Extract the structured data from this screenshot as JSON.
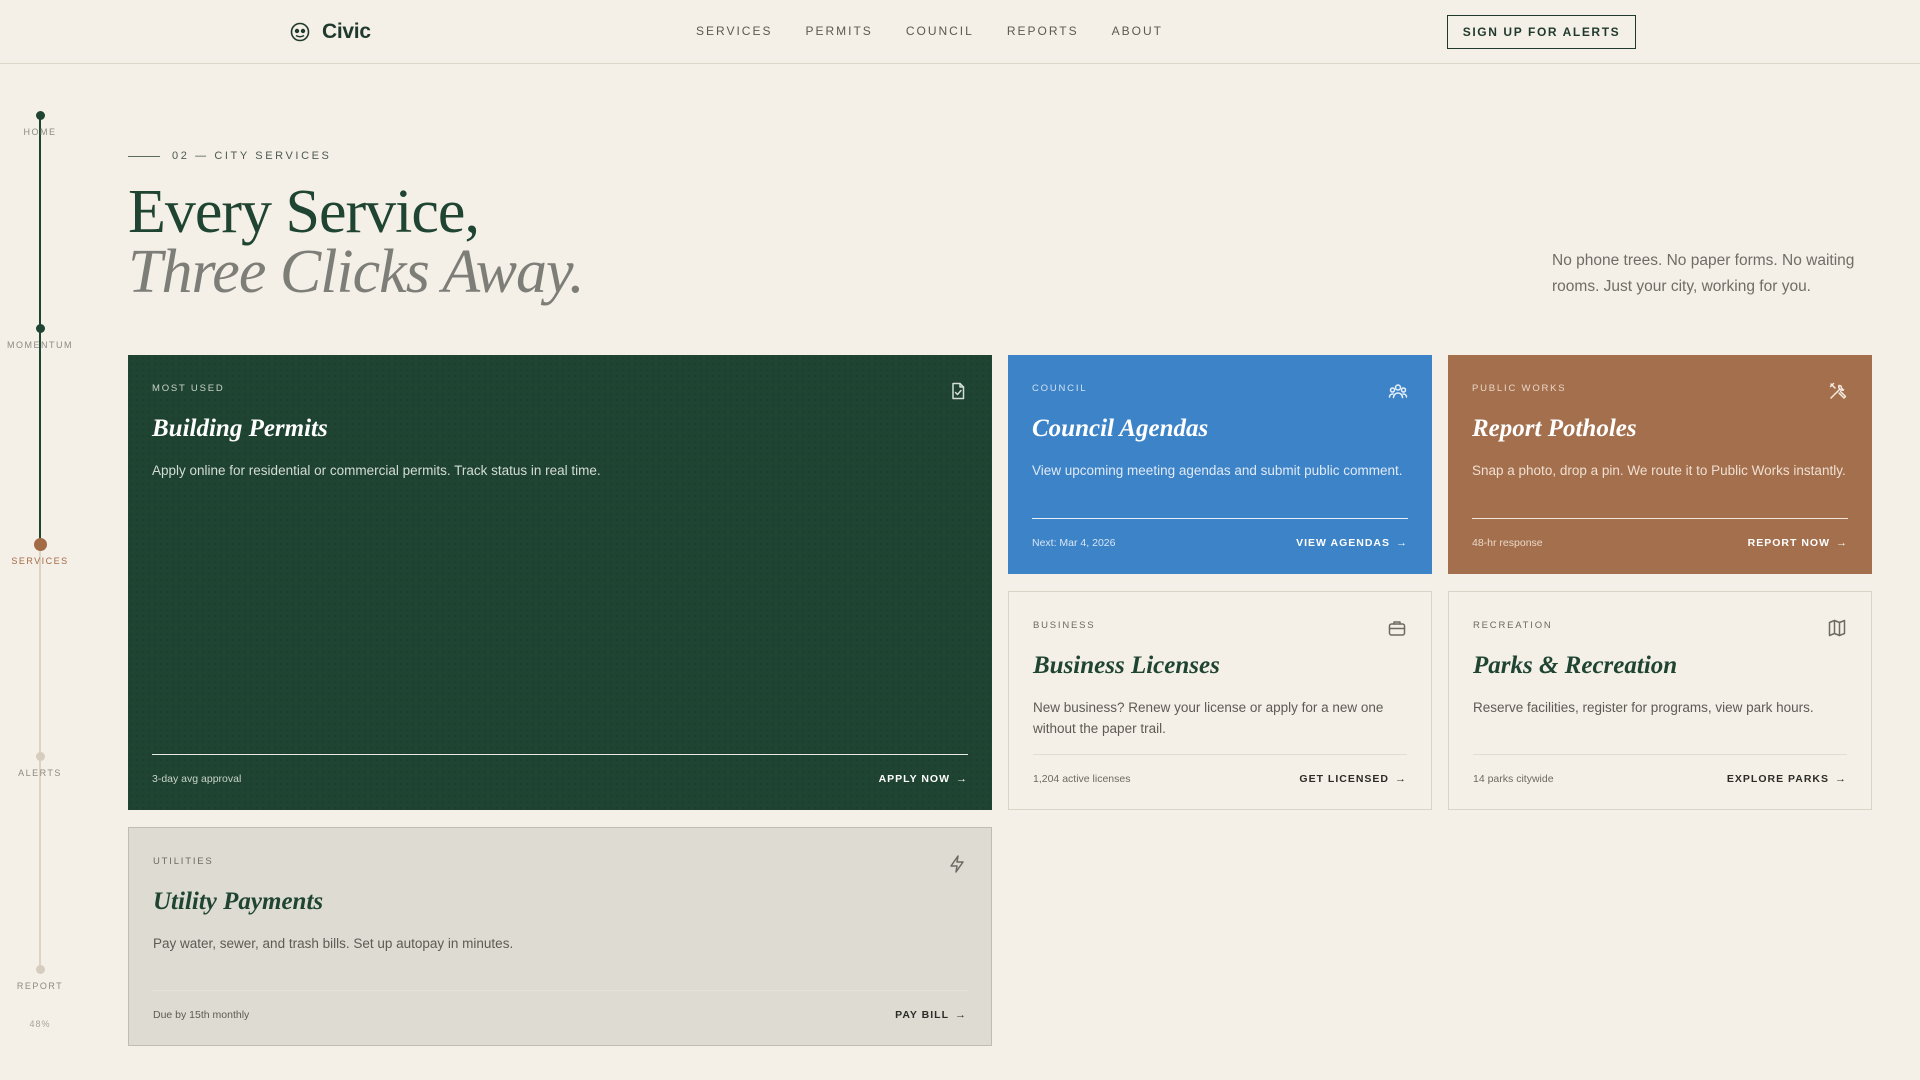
{
  "header": {
    "brand": "Civic",
    "nav": [
      "SERVICES",
      "PERMITS",
      "COUNCIL",
      "REPORTS",
      "ABOUT"
    ],
    "cta": "SIGN UP FOR ALERTS"
  },
  "rail": {
    "steps": [
      "HOME",
      "MOMENTUM",
      "SERVICES",
      "ALERTS",
      "REPORT"
    ],
    "current": "SERVICES",
    "percent": "48%"
  },
  "section": {
    "eyebrow": "02 — CITY SERVICES",
    "headline_1": "Every Service,",
    "headline_2": "Three Clicks Away.",
    "intro": "No phone trees. No paper forms. No waiting rooms. Just your city, working for you."
  },
  "cards": {
    "permits": {
      "tag": "MOST USED",
      "title": "Building Permits",
      "desc": "Apply online for residential or commercial permits. Track status in real time.",
      "meta": "3-day avg approval",
      "action": "APPLY NOW",
      "icon": "document-check-icon",
      "color": "#1f4432"
    },
    "council": {
      "tag": "COUNCIL",
      "title": "Council Agendas",
      "desc": "View upcoming meeting agendas and submit public comment.",
      "meta": "Next: Mar 4, 2026",
      "action": "VIEW AGENDAS",
      "icon": "people-icon",
      "color": "#3d83c7"
    },
    "potholes": {
      "tag": "PUBLIC WORKS",
      "title": "Report Potholes",
      "desc": "Snap a photo, drop a pin. We route it to Public Works instantly.",
      "meta": "48-hr response",
      "action": "REPORT NOW",
      "icon": "tools-icon",
      "color": "#a36f4d"
    },
    "business": {
      "tag": "BUSINESS",
      "title": "Business Licenses",
      "desc": "New business? Renew your license or apply for a new one without the paper trail.",
      "meta": "1,204 active licenses",
      "action": "GET LICENSED",
      "icon": "briefcase-icon"
    },
    "parks": {
      "tag": "RECREATION",
      "title": "Parks & Recreation",
      "desc": "Reserve facilities, register for programs, view park hours.",
      "meta": "14 parks citywide",
      "action": "EXPLORE PARKS",
      "icon": "map-icon"
    },
    "utility": {
      "tag": "UTILITIES",
      "title": "Utility Payments",
      "desc": "Pay water, sewer, and trash bills. Set up autopay in minutes.",
      "meta": "Due by 15th monthly",
      "action": "PAY BILL",
      "icon": "lightning-icon"
    }
  },
  "icons": {
    "arrow": "→"
  }
}
